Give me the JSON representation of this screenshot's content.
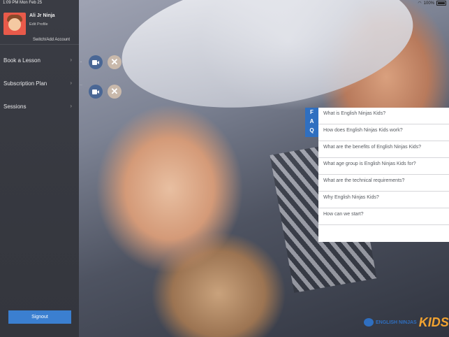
{
  "status_bar": {
    "time": "1:09 PM  Mon Feb 25",
    "battery": "100%"
  },
  "profile": {
    "name": "Ali Jr Ninja",
    "edit_label": "Edit Profile",
    "switch_label": "Switch/Add Account"
  },
  "nav": [
    {
      "label": "Book a Lesson"
    },
    {
      "label": "Subscription Plan"
    },
    {
      "label": "Sessions"
    }
  ],
  "signout_label": "Signout",
  "faq": {
    "tab_letters": [
      "F",
      "A",
      "Q"
    ],
    "items": [
      "What is English Ninjas Kids?",
      "How does English Ninjas Kids work?",
      "What are the benefits of English Ninjas Kids?",
      "What age group is English Ninjas Kids for?",
      "What are the technical requirements?",
      "Why English Ninjas Kids?",
      "How can we start?"
    ]
  },
  "logo": {
    "text": "ENGLISH NINJAS",
    "kids": "KIDS"
  },
  "colors": {
    "accent": "#2f6fc0",
    "sidebar": "#3a3c44",
    "kids_orange": "#f2a330"
  },
  "icons": [
    "wifi-icon",
    "battery-icon",
    "video-camera-icon",
    "close-icon",
    "chevron-right-icon"
  ]
}
